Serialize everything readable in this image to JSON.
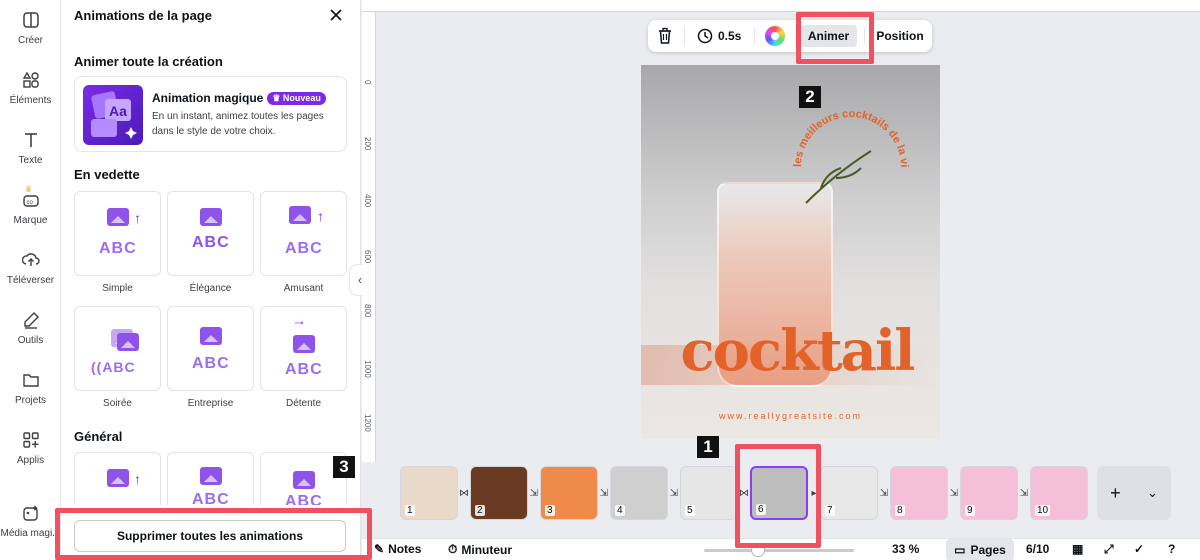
{
  "rail": {
    "items": [
      {
        "label": "Créer",
        "icon": "create-icon"
      },
      {
        "label": "Éléments",
        "icon": "elements-icon"
      },
      {
        "label": "Texte",
        "icon": "text-icon"
      },
      {
        "label": "Marque",
        "icon": "brand-icon"
      },
      {
        "label": "Téléverser",
        "icon": "upload-icon"
      },
      {
        "label": "Outils",
        "icon": "tools-icon"
      },
      {
        "label": "Projets",
        "icon": "folder-icon"
      },
      {
        "label": "Applis",
        "icon": "apps-icon"
      },
      {
        "label": "Média magi...",
        "icon": "magic-media-icon"
      }
    ]
  },
  "panel": {
    "title": "Animations de la page",
    "section_all": "Animer toute la création",
    "magic": {
      "name": "Animation magique",
      "badge": "Nouveau",
      "description": "En un instant, animez toutes les pages dans le style de votre choix.",
      "thumb_text": "Aa"
    },
    "section_featured": "En vedette",
    "featured": [
      {
        "label": "Simple",
        "sample": "ABC"
      },
      {
        "label": "Élégance",
        "sample": "ABC"
      },
      {
        "label": "Amusant",
        "sample": "ABC"
      },
      {
        "label": "Soirée",
        "sample": "((ABC"
      },
      {
        "label": "Entreprise",
        "sample": "ABC"
      },
      {
        "label": "Détente",
        "sample": "ABC"
      }
    ],
    "section_general": "Général",
    "general": [
      {
        "sample": ""
      },
      {
        "sample": "ABC"
      },
      {
        "sample": "ABC"
      }
    ],
    "remove_all": "Supprimer toutes les animations"
  },
  "ruler": {
    "left_ticks": [
      "0",
      "200",
      "400",
      "600",
      "800",
      "1000",
      "1200"
    ]
  },
  "toolbar": {
    "duration": "0.5s",
    "animate": "Animer",
    "position": "Position"
  },
  "page": {
    "arc_text": "les meilleurs cocktails de la ville pourcette été",
    "title": "cocktail",
    "url": "www.reallygreatsite.com"
  },
  "thumbnails": [
    {
      "num": "1",
      "bg": "#e9d9c8"
    },
    {
      "num": "2",
      "bg": "#6b3a22"
    },
    {
      "num": "3",
      "bg": "#f08a4a"
    },
    {
      "num": "4",
      "bg": "#cfcfcf"
    },
    {
      "num": "5",
      "bg": "#e6e6e6"
    },
    {
      "num": "6",
      "bg": "#bdbdbd"
    },
    {
      "num": "7",
      "bg": "#e8e8e8"
    },
    {
      "num": "8",
      "bg": "#f6bfd9"
    },
    {
      "num": "9",
      "bg": "#f6bfd9"
    },
    {
      "num": "10",
      "bg": "#f6bfd9"
    }
  ],
  "bottombar": {
    "notes": "Notes",
    "timer": "Minuteur",
    "zoom": "33 %",
    "pages": "Pages",
    "page_count": "6/10"
  },
  "annotations": {
    "tag1": "1",
    "tag2": "2",
    "tag3": "3"
  },
  "colors": {
    "accent": "#8b3dff",
    "highlight": "#f0505f",
    "title_orange": "#e2622a"
  }
}
